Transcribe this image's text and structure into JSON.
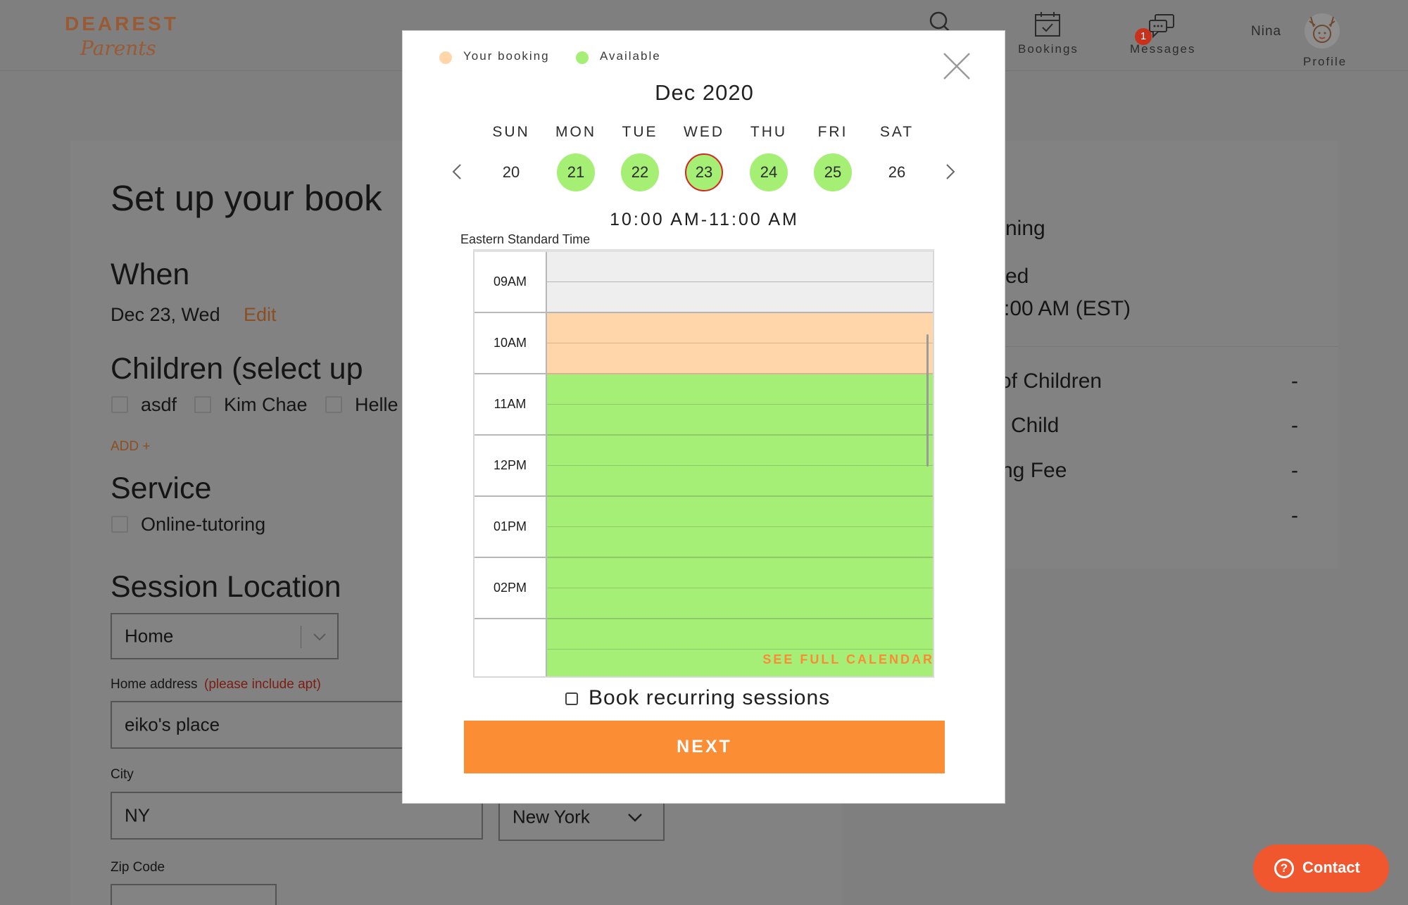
{
  "header": {
    "logo_top": "DEAREST",
    "logo_bottom": "Parents",
    "bookings_label": "Bookings",
    "messages_label": "Messages",
    "messages_badge": "1",
    "user_name": "Nina",
    "profile_label": "Profile",
    "icons": [
      "search-icon",
      "calendar-icon",
      "chat-icon",
      "avatar"
    ]
  },
  "form": {
    "title": "Set up your book",
    "when_heading": "When",
    "when_value": "Dec 23, Wed",
    "edit_label": "Edit",
    "children_heading": "Children (select up",
    "children": [
      "asdf",
      "Kim Chae",
      "Helle"
    ],
    "add_label": "ADD +",
    "service_heading": "Service",
    "service_option": "Online-tutoring",
    "location_heading": "Session Location",
    "location_select": "Home",
    "home_address_label": "Home address",
    "home_address_note": "(please include apt)",
    "home_address_value": "eiko's place",
    "city_label": "City",
    "city_value": "NY",
    "state_value": "New York",
    "zip_label": "Zip Code"
  },
  "summary": {
    "line1": "ning",
    "line2": "ed",
    "line3": ":00 AM (EST)",
    "rows": [
      {
        "label": "of Children",
        "value": "-"
      },
      {
        "label": "Child",
        "value": "-"
      },
      {
        "label": "ng Fee",
        "value": "-"
      },
      {
        "label": "",
        "value": "-"
      }
    ]
  },
  "modal": {
    "legend_booking": "Your booking",
    "legend_available": "Available",
    "month": "Dec 2020",
    "day_names": [
      "SUN",
      "MON",
      "TUE",
      "WED",
      "THU",
      "FRI",
      "SAT"
    ],
    "day_numbers": [
      "20",
      "21",
      "22",
      "23",
      "24",
      "25",
      "26"
    ],
    "selected_time": "10:00 AM-11:00 AM",
    "timezone": "Eastern Standard Time",
    "hours": [
      "09AM",
      "10AM",
      "11AM",
      "12PM",
      "01PM",
      "02PM"
    ],
    "see_full_calendar": "SEE FULL CALENDAR",
    "recurring_label": "Book recurring sessions",
    "next_label": "NEXT",
    "colors": {
      "booking": "#ffd6aa",
      "available": "#a6ef76",
      "selected_ring": "#d8241c",
      "accent": "#fb8d34"
    }
  },
  "contact": {
    "label": "Contact",
    "icon": "help-icon"
  }
}
